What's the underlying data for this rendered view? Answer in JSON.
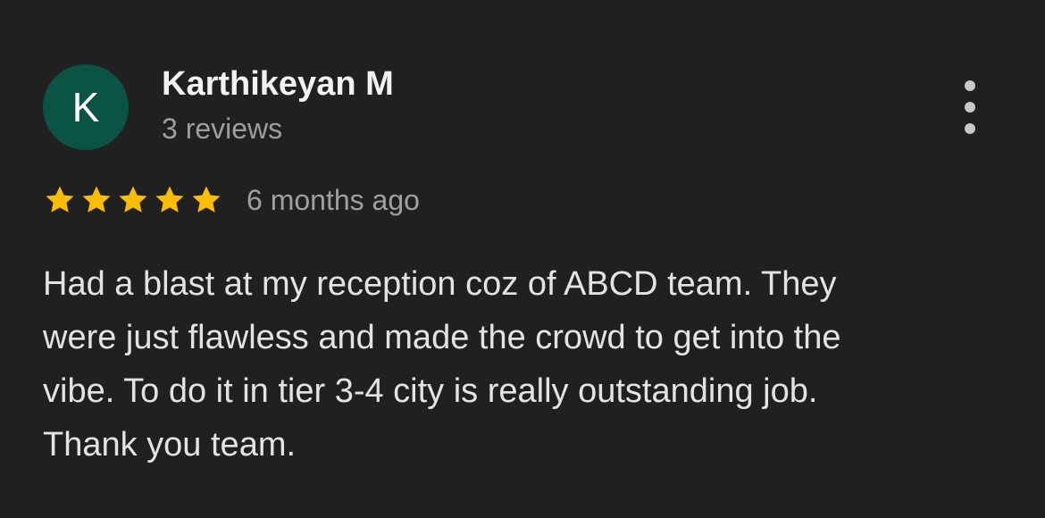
{
  "review": {
    "author": {
      "initial": "K",
      "name": "Karthikeyan M",
      "reviews_count": "3 reviews",
      "avatar_color": "#0b5345"
    },
    "menu_icon": "more-vert-icon",
    "rating": {
      "value": 5,
      "max": 5,
      "star_color": "#fbbc04",
      "icon": "star-icon"
    },
    "timestamp": "6 months ago",
    "text_lines": [
      "Had a blast at my reception coz of ABCD team. They",
      "were just flawless and made the crowd to get into the",
      "vibe. To do it in tier 3-4 city is really outstanding job.",
      "Thank you team."
    ]
  },
  "colors": {
    "background": "#202020",
    "primary_text": "#e3e3e3",
    "secondary_text": "#9e9e9e",
    "menu_dots": "#c8c8c8"
  }
}
